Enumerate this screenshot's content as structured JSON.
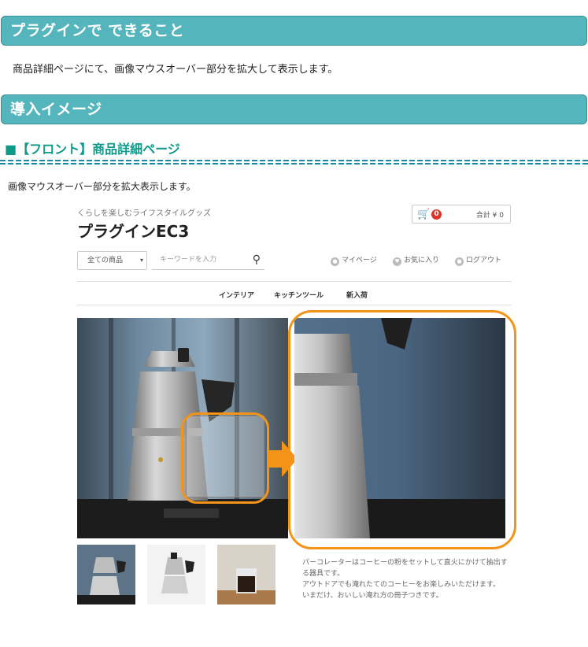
{
  "section1": {
    "title": "プラグインで できること",
    "text": "商品詳細ページにて、画像マウスオーバー部分を拡大して表示します。"
  },
  "section2": {
    "title": "導入イメージ"
  },
  "section3": {
    "title": "■【フロント】商品詳細ページ",
    "text": "画像マウスオーバー部分を拡大表示します。"
  },
  "shop": {
    "tagline": "くらしを楽しむライフスタイルグッズ",
    "name": "プラグインEC3",
    "cart_count": "0",
    "cart_total": "合計 ¥ 0",
    "category_select": "全ての商品",
    "search_placeholder": "キーワードを入力",
    "user_links": [
      "マイページ",
      "お気に入り",
      "ログアウト"
    ],
    "categories": [
      "インテリア",
      "キッチンツール",
      "新入荷"
    ],
    "description": [
      "パーコレーターはコーヒーの粉をセットして直火にかけて抽出する器具です。",
      "アウトドアでも淹れたてのコーヒーをお楽しみいただけます。",
      "いまだけ、おいしい淹れ方の冊子つきです。"
    ]
  },
  "colors": {
    "header_bar": "#55b5bc",
    "accent_heading": "#0f9a8a",
    "highlight": "#f39418",
    "badge": "#d9352b"
  }
}
